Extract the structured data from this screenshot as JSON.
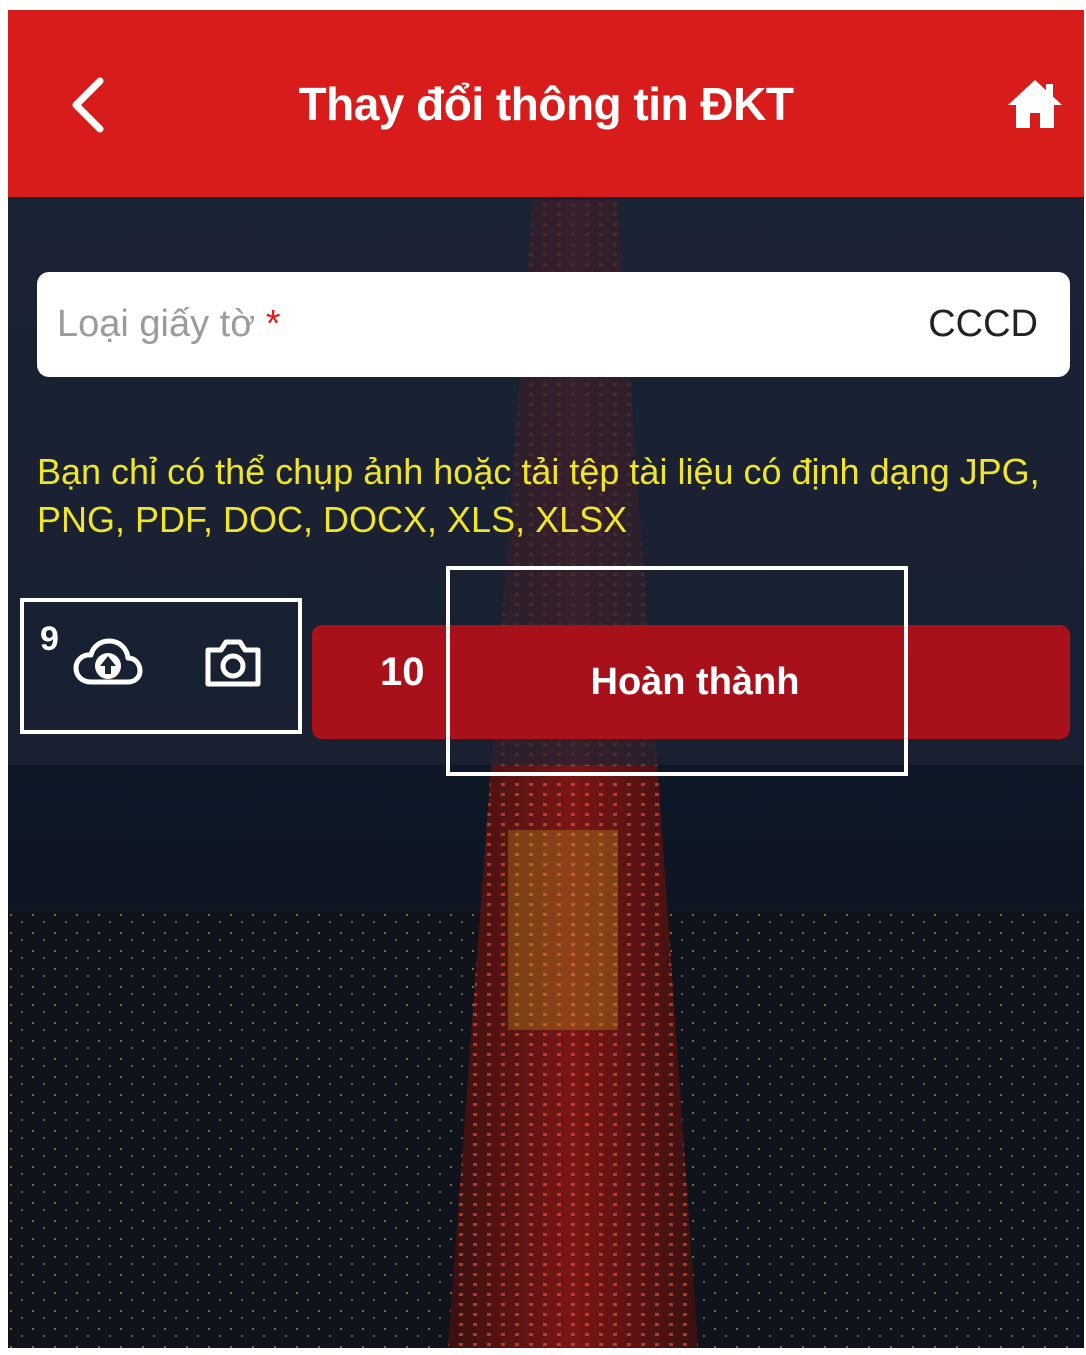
{
  "header": {
    "title": "Thay đổi thông tin ĐKT",
    "back_icon": "chevron-left-icon",
    "home_icon": "home-icon",
    "background_color": "#d81c1c"
  },
  "form": {
    "document_type": {
      "label": "Loại giấy tờ",
      "required_mark": "*",
      "value": "CCCD"
    },
    "note": "Bạn chỉ có thể chụp ảnh hoặc tải tệp tài liệu có định dạng JPG, PNG, PDF, DOC, DOCX, XLS, XLSX",
    "note_color": "#f1e52c",
    "upload_icon": "cloud-upload-icon",
    "camera_icon": "camera-icon",
    "complete_button_label": "Hoàn thành",
    "complete_button_color": "#a8111a"
  },
  "annotations": {
    "media_marker": "9",
    "complete_marker": "10"
  }
}
